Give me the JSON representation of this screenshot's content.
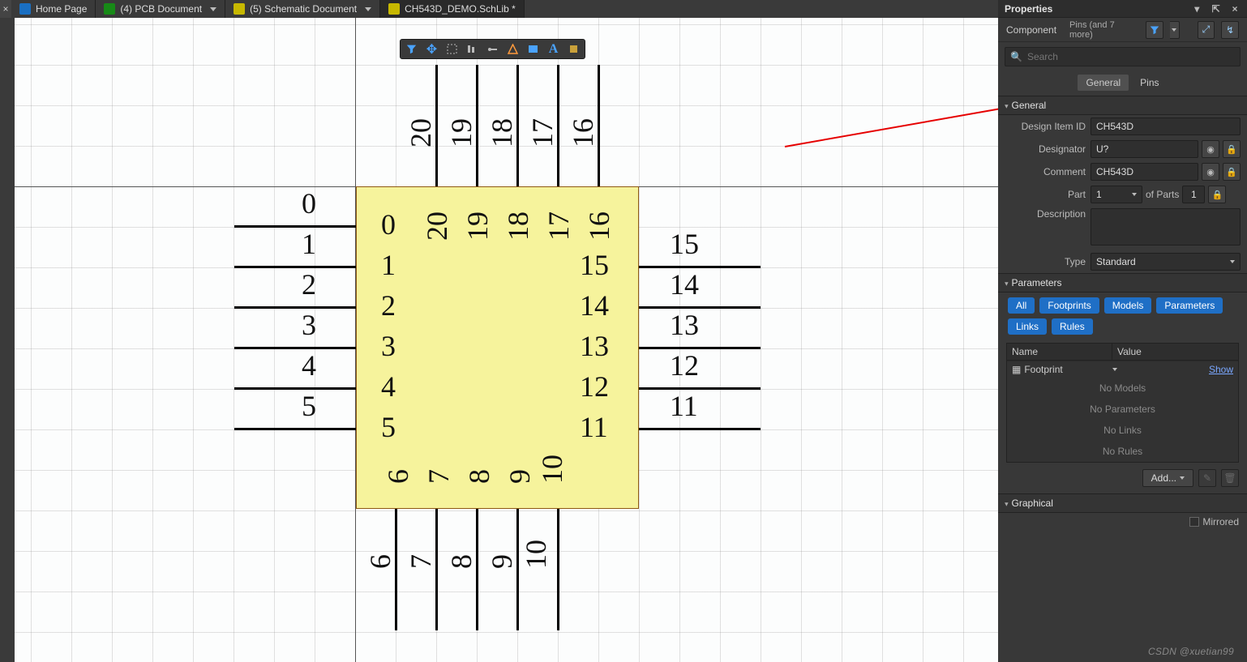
{
  "tabs": {
    "home": "Home Page",
    "pcb": "(4) PCB Document",
    "sch": "(5) Schematic Document",
    "file": "CH543D_DEMO.SchLib *"
  },
  "properties": {
    "title": "Properties",
    "subLabel": "Component",
    "subRight": "Pins (and 7 more)",
    "searchPlaceholder": "Search",
    "tabGeneral": "General",
    "tabPins": "Pins",
    "sectionGeneral": "General",
    "designItemId": {
      "label": "Design Item ID",
      "value": "CH543D"
    },
    "designator": {
      "label": "Designator",
      "value": "U?"
    },
    "comment": {
      "label": "Comment",
      "value": "CH543D"
    },
    "part": {
      "label": "Part",
      "value": "1",
      "ofLabel": "of Parts",
      "ofValue": "1"
    },
    "description": {
      "label": "Description",
      "value": ""
    },
    "type": {
      "label": "Type",
      "value": "Standard"
    },
    "sectionParameters": "Parameters",
    "pills": [
      "All",
      "Footprints",
      "Models",
      "Parameters",
      "Links",
      "Rules"
    ],
    "table": {
      "colName": "Name",
      "colValue": "Value"
    },
    "paramRow": {
      "name": "Footprint",
      "value": "Show"
    },
    "placeholders": [
      "No Models",
      "No Parameters",
      "No Links",
      "No Rules"
    ],
    "addLabel": "Add...",
    "sectionGraphical": "Graphical",
    "mirrored": "Mirrored"
  },
  "schematic": {
    "left": {
      "outer": [
        "0",
        "1",
        "2",
        "3",
        "4",
        "5"
      ],
      "inner": [
        "0",
        "1",
        "2",
        "3",
        "4",
        "5"
      ]
    },
    "right": {
      "outer": [
        "15",
        "14",
        "13",
        "12",
        "11"
      ],
      "inner": [
        "15",
        "14",
        "13",
        "12",
        "11"
      ]
    },
    "top": {
      "outer": [
        "20",
        "19",
        "18",
        "17",
        "16"
      ],
      "inner": [
        "20",
        "19",
        "18",
        "17",
        "16"
      ]
    },
    "bottom": {
      "outer": [
        "6",
        "7",
        "8",
        "9",
        "10"
      ],
      "inner": [
        "6",
        "7",
        "8",
        "9",
        "10"
      ]
    }
  },
  "watermark": "CSDN @xuetian99"
}
